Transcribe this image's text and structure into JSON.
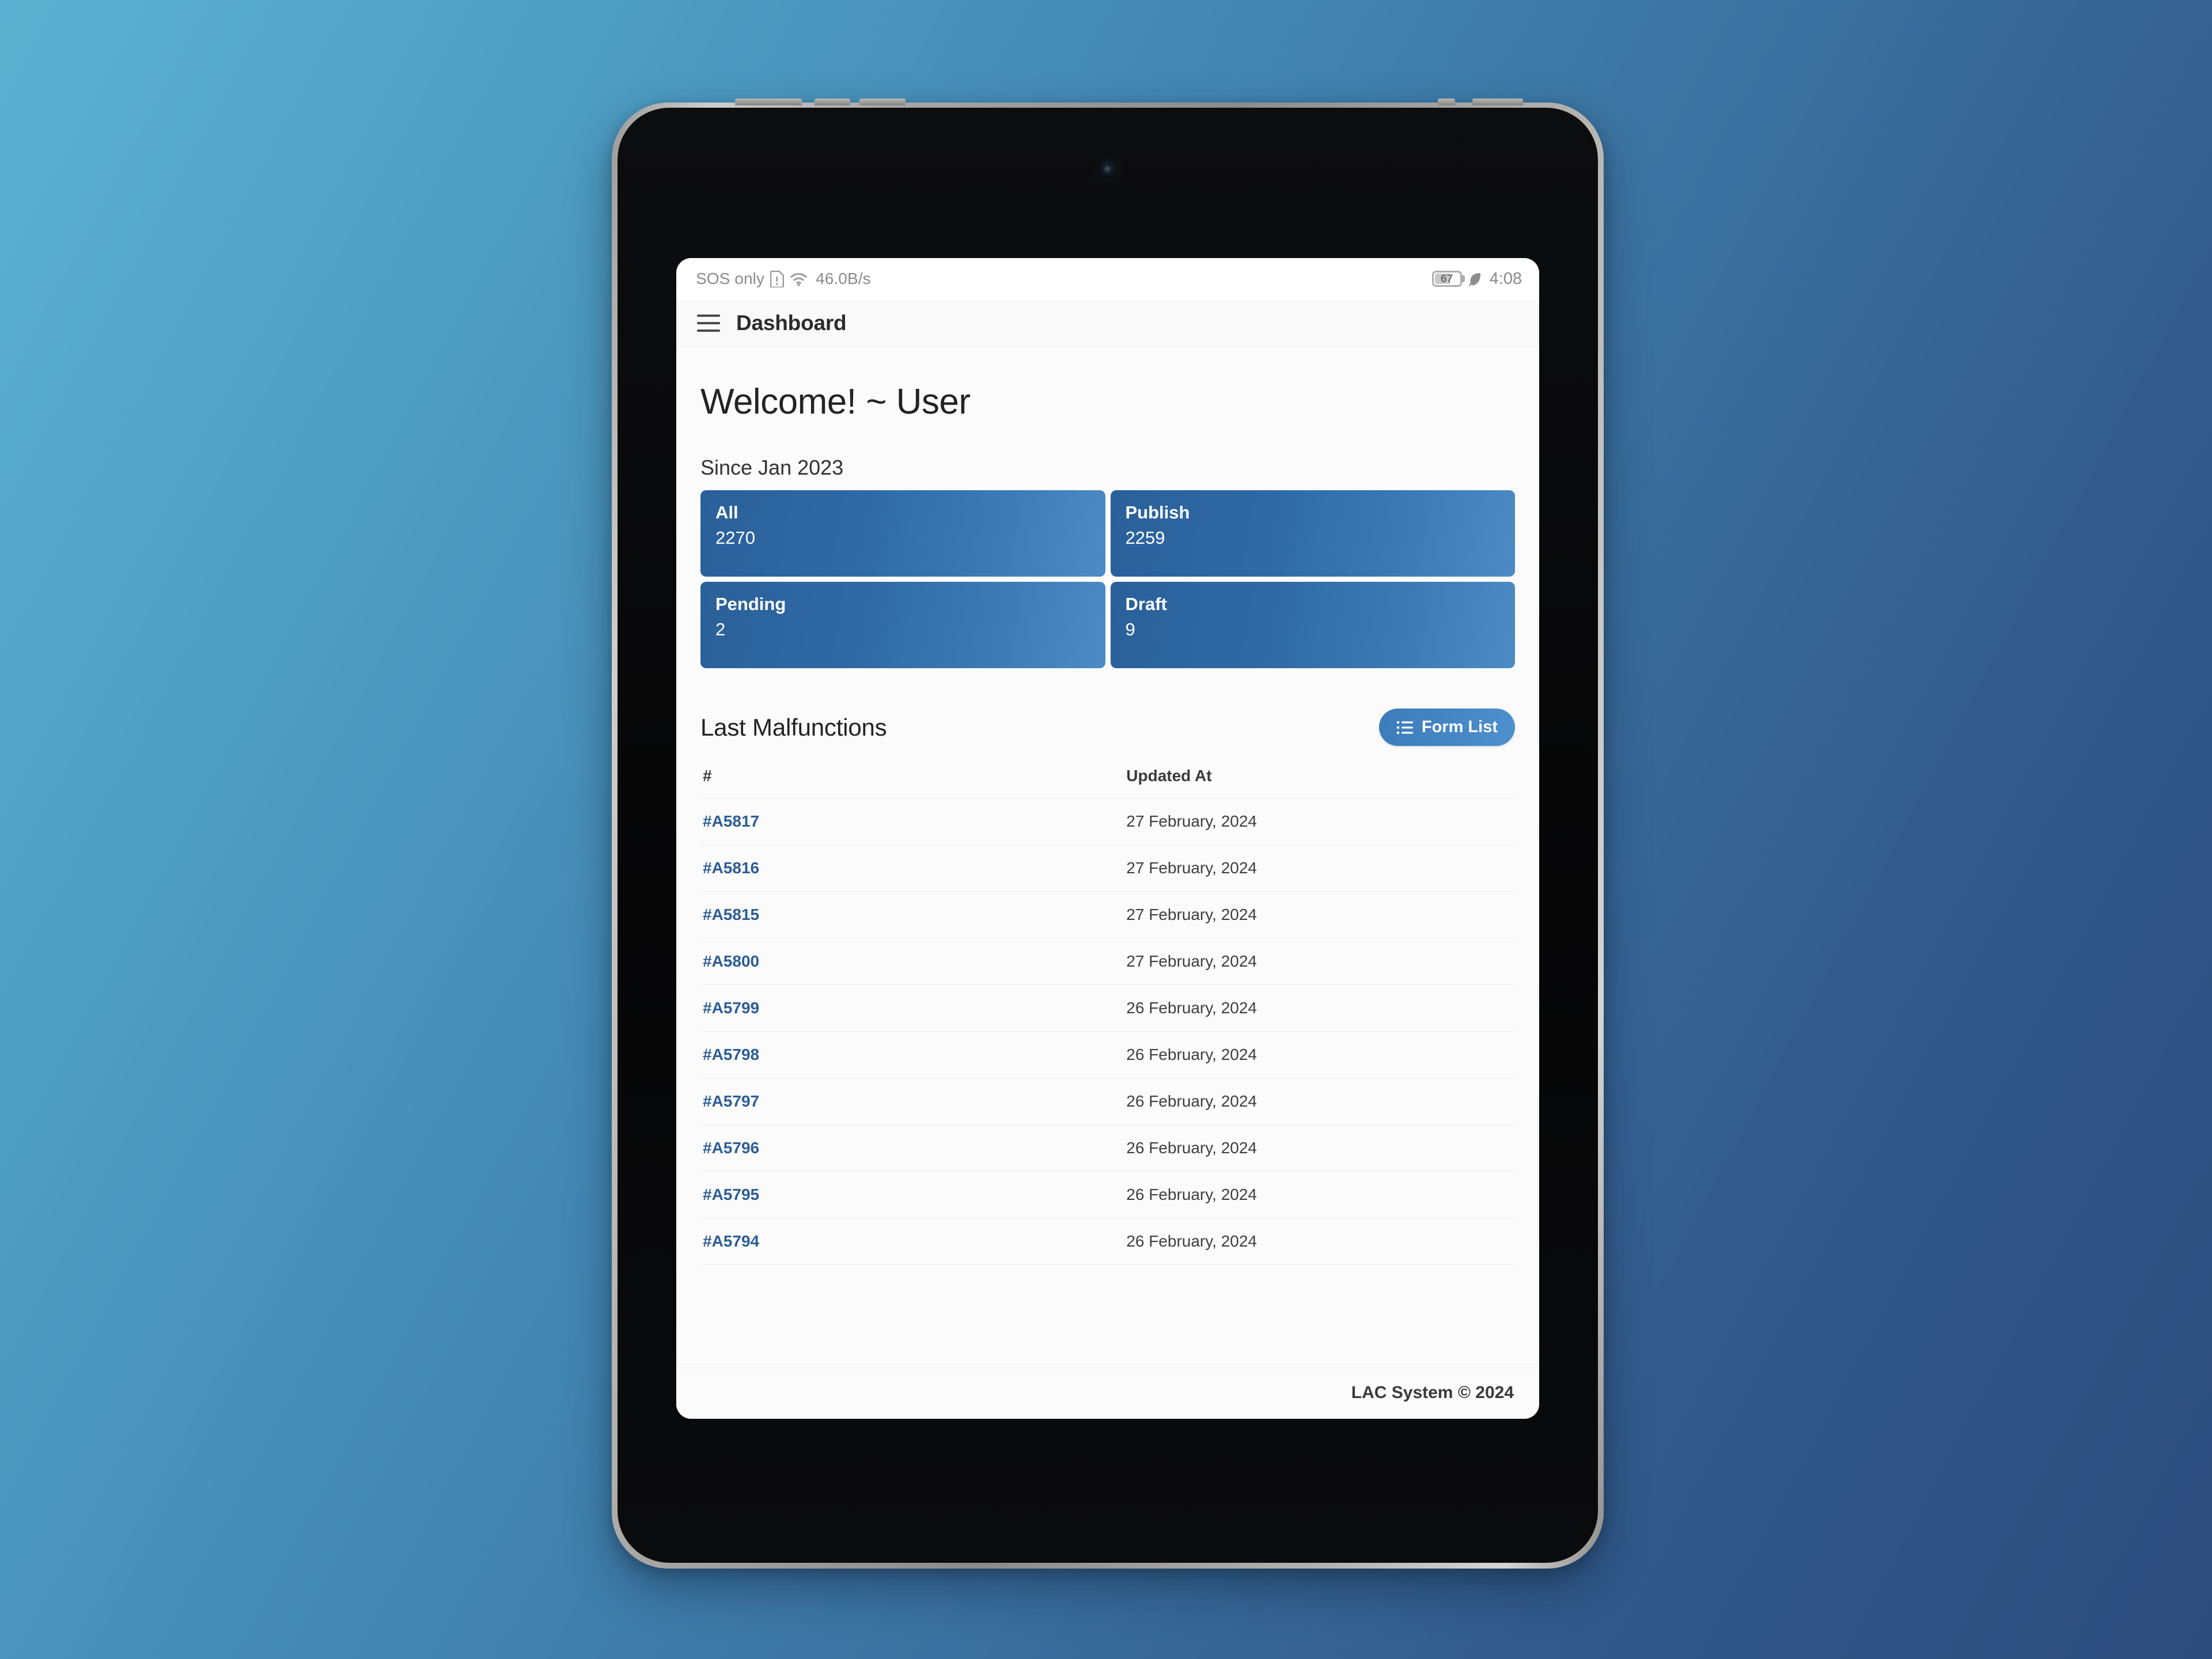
{
  "status_bar": {
    "carrier": "SOS only",
    "sim_icon": "sim-alert-icon",
    "wifi_icon": "wifi-icon",
    "network_speed": "46.0B/s",
    "battery_level": "67",
    "power_save_icon": "leaf-icon",
    "time": "4:08"
  },
  "app_bar": {
    "menu_icon": "hamburger-menu-icon",
    "title": "Dashboard"
  },
  "main": {
    "welcome": "Welcome! ~ User",
    "since_label": "Since Jan 2023",
    "stats": [
      {
        "label": "All",
        "value": "2270"
      },
      {
        "label": "Publish",
        "value": "2259"
      },
      {
        "label": "Pending",
        "value": "2"
      },
      {
        "label": "Draft",
        "value": "9"
      }
    ],
    "section_title": "Last Malfunctions",
    "form_list_button": "Form List",
    "form_list_icon": "bulleted-list-icon",
    "table": {
      "columns": [
        "#",
        "Updated At"
      ],
      "rows": [
        {
          "id": "#A5817",
          "updated_at": "27 February, 2024"
        },
        {
          "id": "#A5816",
          "updated_at": "27 February, 2024"
        },
        {
          "id": "#A5815",
          "updated_at": "27 February, 2024"
        },
        {
          "id": "#A5800",
          "updated_at": "27 February, 2024"
        },
        {
          "id": "#A5799",
          "updated_at": "26 February, 2024"
        },
        {
          "id": "#A5798",
          "updated_at": "26 February, 2024"
        },
        {
          "id": "#A5797",
          "updated_at": "26 February, 2024"
        },
        {
          "id": "#A5796",
          "updated_at": "26 February, 2024"
        },
        {
          "id": "#A5795",
          "updated_at": "26 February, 2024"
        },
        {
          "id": "#A5794",
          "updated_at": "26 February, 2024"
        }
      ]
    }
  },
  "footer": {
    "copyright": "LAC System © 2024"
  },
  "colors": {
    "accent_blue": "#2a6099",
    "accent_blue_light": "#4d8bc6",
    "link_blue": "#2d5d95",
    "background_from": "#5cb1d1",
    "background_to": "#2c4c7d"
  }
}
